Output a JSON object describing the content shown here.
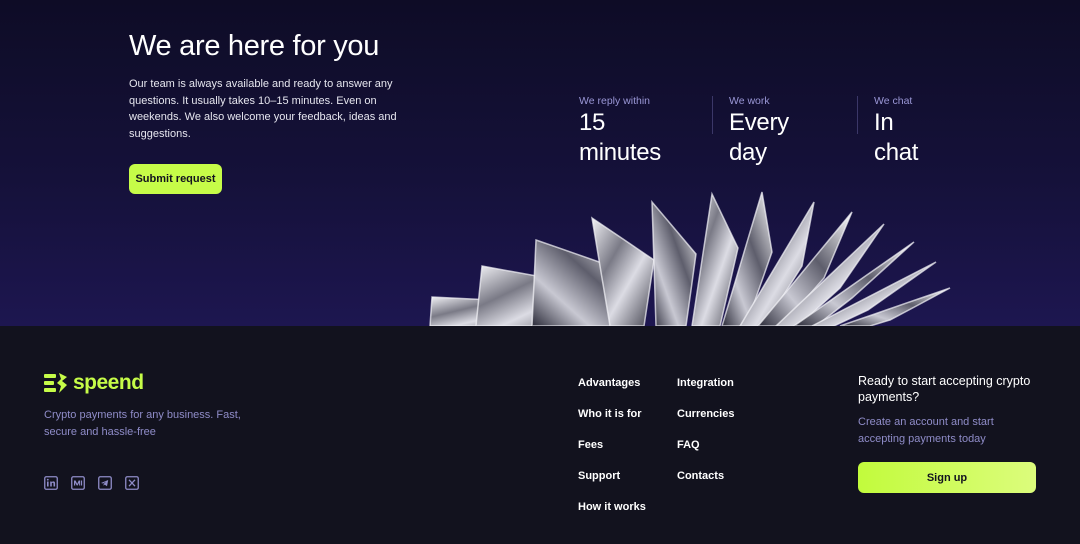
{
  "hero": {
    "title": "We are here for you",
    "text": "Our team is always available and ready to answer any questions. It usually takes 10–15 minutes. Even on weekends. We also welcome your feedback, ideas and suggestions.",
    "submit_label": "Submit request"
  },
  "stats": [
    {
      "label": "We reply within",
      "value": "15 minutes"
    },
    {
      "label": "We work",
      "value": "Every day"
    },
    {
      "label": "We chat",
      "value": "In chat"
    }
  ],
  "footer": {
    "logo_text": "speend",
    "tagline": "Crypto payments for any business. Fast, secure and hassle-free",
    "socials": [
      "linkedin-icon",
      "medium-icon",
      "telegram-icon",
      "x-icon"
    ],
    "nav_col1": [
      "Advantages",
      "Who it is for",
      "Fees",
      "Support",
      "How it works"
    ],
    "nav_col2": [
      "Integration",
      "Currencies",
      "FAQ",
      "Contacts"
    ],
    "cta_title": "Ready to start accepting crypto payments?",
    "cta_text": "Create an account and start accepting payments today",
    "signup_label": "Sign up"
  },
  "colors": {
    "accent": "#c6fc48",
    "hero_bg": "#15113a",
    "footer_bg": "#12121e",
    "muted_text": "#8f8cc8"
  }
}
